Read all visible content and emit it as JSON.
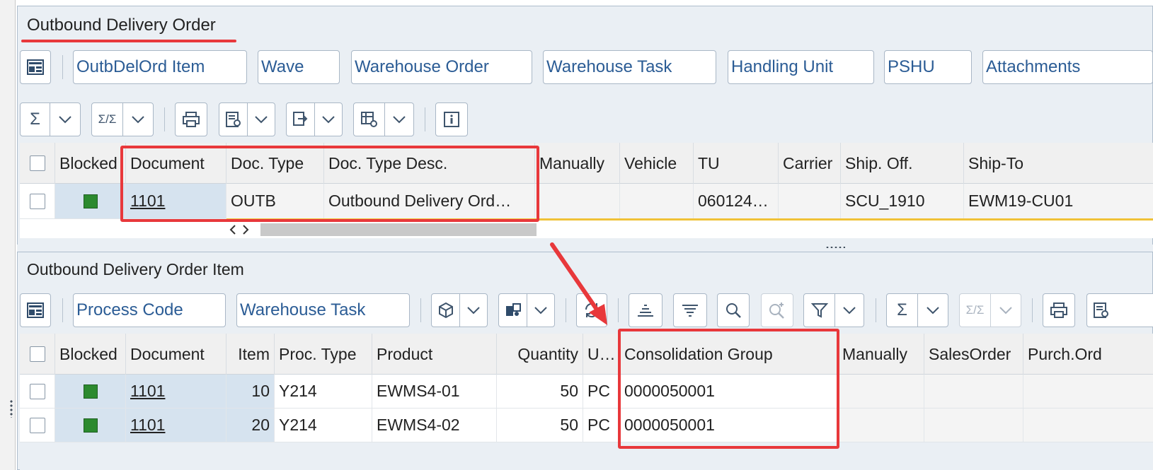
{
  "top_panel": {
    "title": "Outbound Delivery Order",
    "tabs": [
      "OutbDelOrd Item",
      "Wave",
      "Warehouse Order",
      "Warehouse Task",
      "Handling Unit",
      "PSHU",
      "Attachments"
    ],
    "columns": [
      "Blocked",
      "Document",
      "Doc. Type",
      "Doc. Type Desc.",
      "Manually",
      "Vehicle",
      "TU",
      "Carrier",
      "Ship. Off.",
      "Ship-To"
    ],
    "rows": [
      {
        "document": "1101",
        "doc_type": "OUTB",
        "doc_type_desc": "Outbound Delivery Ord…",
        "manually": "",
        "vehicle": "",
        "tu": "060124…",
        "carrier": "",
        "ship_off": "SCU_1910",
        "ship_to": "EWM19-CU01"
      }
    ],
    "toolbar_sum": "Σ",
    "toolbar_subtotal": "Σ/Σ"
  },
  "bottom_panel": {
    "title": "Outbound Delivery Order Item",
    "tabs": [
      "Process Code",
      "Warehouse Task"
    ],
    "columns": [
      "Blocked",
      "Document",
      "Item",
      "Proc. Type",
      "Product",
      "Quantity",
      "U…",
      "Consolidation Group",
      "Manually",
      "SalesOrder",
      "Purch.Ord"
    ],
    "rows": [
      {
        "document": "1101",
        "item": "10",
        "proc_type": "Y214",
        "product": "EWMS4-01",
        "quantity": "50",
        "unit": "PC",
        "consolidation_group": "0000050001"
      },
      {
        "document": "1101",
        "item": "20",
        "proc_type": "Y214",
        "product": "EWMS4-02",
        "quantity": "50",
        "unit": "PC",
        "consolidation_group": "0000050001"
      }
    ],
    "toolbar_sum": "Σ",
    "toolbar_subtotal": "Σ/Σ"
  },
  "colors": {
    "highlight": "#e8383b",
    "link": "#2b5c95",
    "status_green": "#2c8a2f"
  }
}
